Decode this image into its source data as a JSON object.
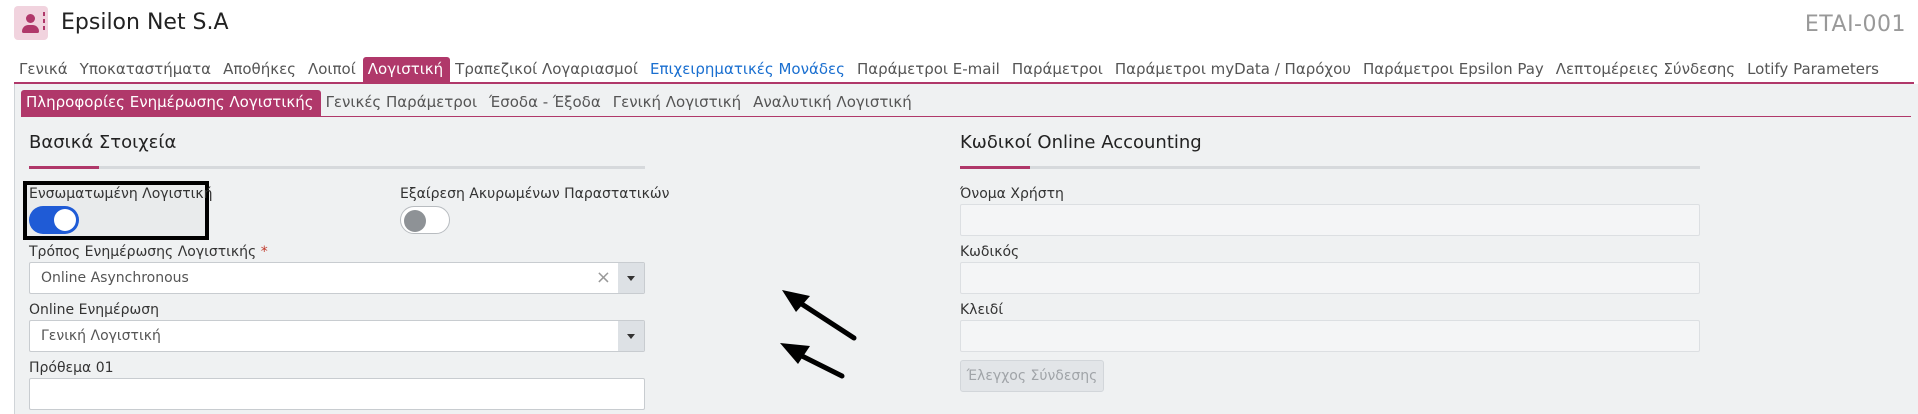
{
  "header": {
    "app_icon": "user-card-icon",
    "title": "Epsilon Net S.A",
    "code": "ETAI-001"
  },
  "main_tabs": [
    {
      "label": "Γενικά"
    },
    {
      "label": "Υποκαταστήματα"
    },
    {
      "label": "Αποθήκες"
    },
    {
      "label": "Λοιποί"
    },
    {
      "label": "Λογιστική",
      "active": true
    },
    {
      "label": "Τραπεζικοί Λογαριασμοί"
    },
    {
      "label": "Επιχειρηματικές Μονάδες"
    },
    {
      "label": "Παράμετροι E-mail"
    },
    {
      "label": "Παράμετροι"
    },
    {
      "label": "Παράμετροι myData / Παρόχου"
    },
    {
      "label": "Παράμετροι Epsilon Pay"
    },
    {
      "label": "Λεπτομέρειες Σύνδεσης"
    },
    {
      "label": "Lotify Parameters"
    }
  ],
  "sub_tabs": [
    {
      "label": "Πληροφορίες Ενημέρωσης Λογιστικής",
      "active": true
    },
    {
      "label": "Γενικές Παράμετροι"
    },
    {
      "label": "Έσοδα - Έξοδα"
    },
    {
      "label": "Γενική Λογιστική"
    },
    {
      "label": "Αναλυτική Λογιστική"
    }
  ],
  "basic": {
    "title": "Βασικά Στοιχεία",
    "integrated_accounting": {
      "label": "Ενσωματωμένη Λογιστική",
      "on": true
    },
    "exclude_cancelled": {
      "label": "Εξαίρεση Ακυρωμένων Παραστατικών",
      "on": false
    },
    "update_mode": {
      "label": "Τρόπος Ενημέρωσης Λογιστικής",
      "required_mark": "*",
      "value": "Online Asynchronous",
      "clear_glyph": "×"
    },
    "online_update": {
      "label": "Online Ενημέρωση",
      "value": "Γενική Λογιστική"
    },
    "prefix": {
      "label": "Πρόθεμα 01",
      "value": ""
    }
  },
  "online_accounting": {
    "title": "Κωδικοί Online Accounting",
    "username": {
      "label": "Όνομα Χρήστη",
      "value": ""
    },
    "password": {
      "label": "Κωδικός",
      "value": ""
    },
    "key": {
      "label": "Κλειδί",
      "value": ""
    },
    "check_button": "Έλεγχος Σύνδεσης"
  },
  "colors": {
    "accent": "#b0386a",
    "toggle_on": "#1f5bd6",
    "link": "#1a6fd0"
  }
}
